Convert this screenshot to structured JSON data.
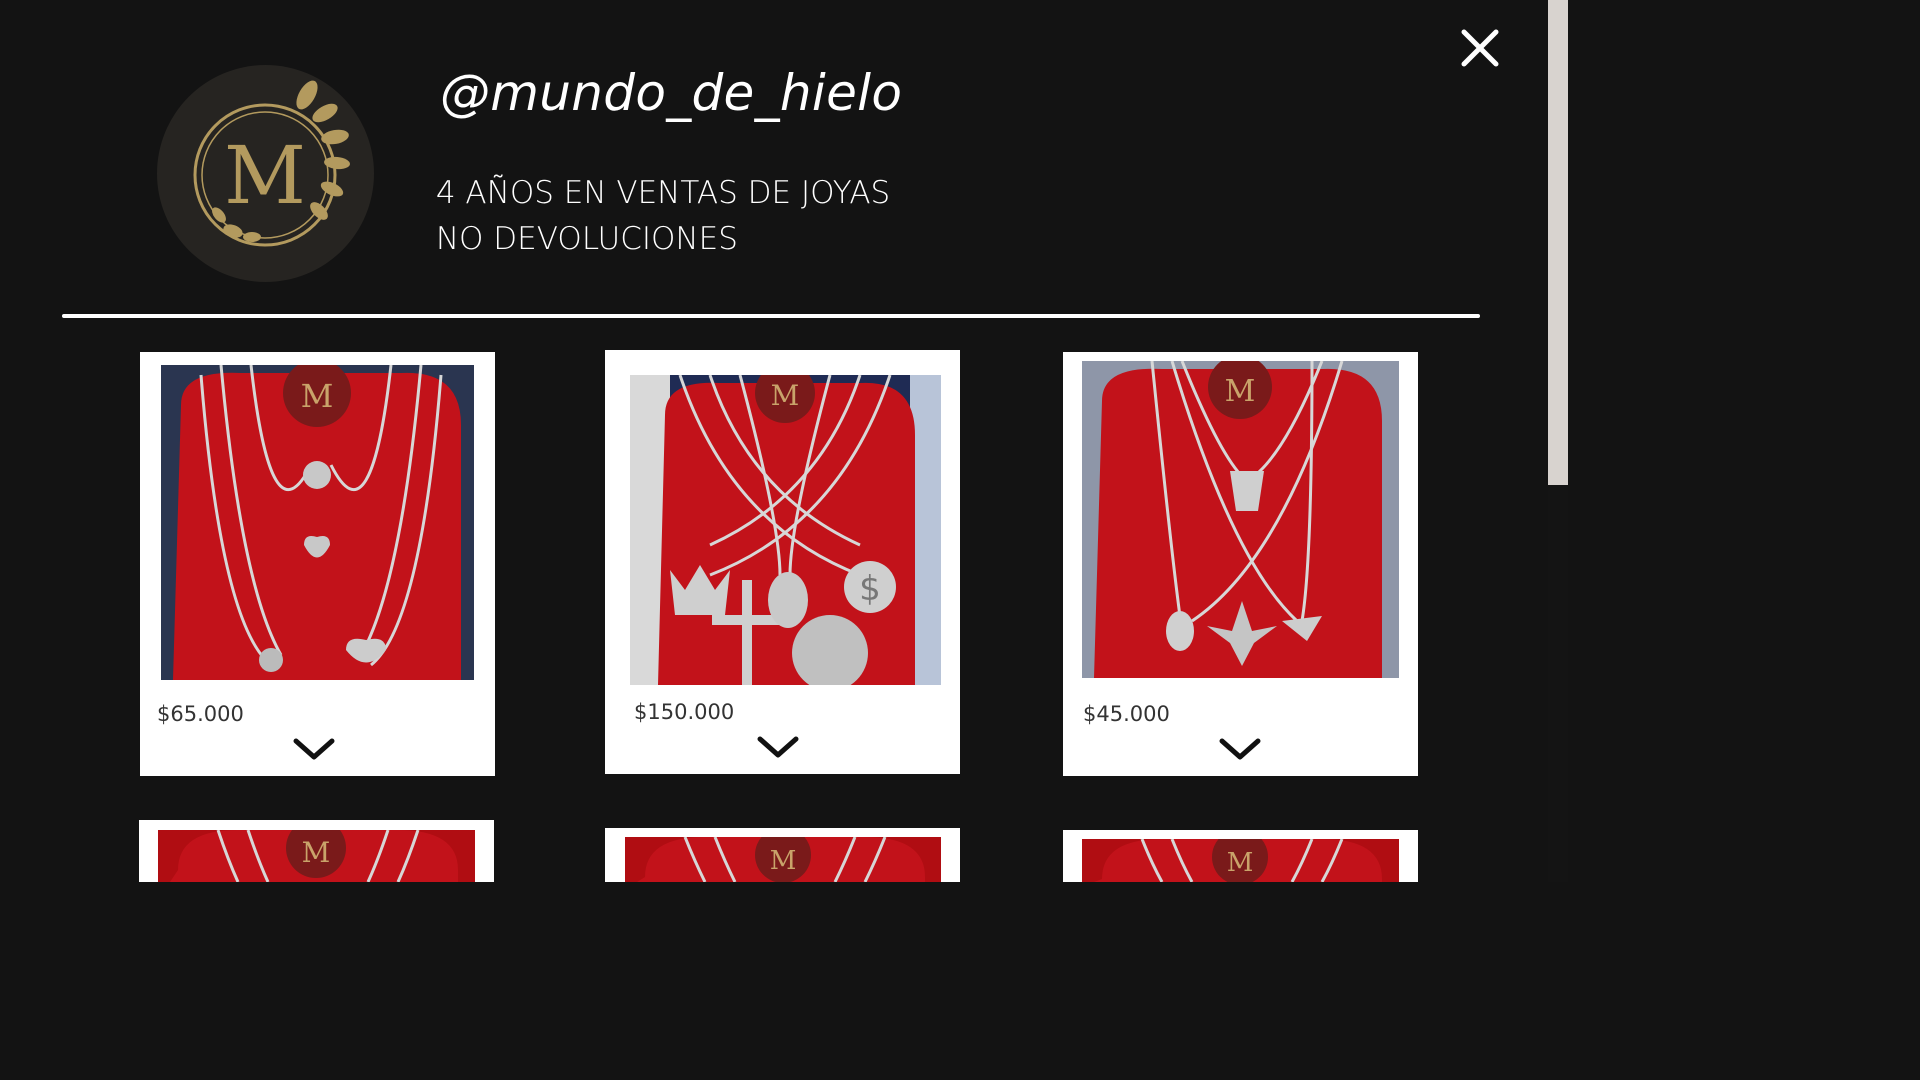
{
  "profile": {
    "handle": "@mundo_de_hielo",
    "bio_line_1": " 4 AÑOS EN VENTAS DE JOYAS ",
    "bio_line_2": " NO DEVOLUCIONES ",
    "logo_letter": "M"
  },
  "colors": {
    "background": "#131313",
    "gold": "#b39a5e",
    "velvet_red": "#c2121a",
    "card": "#ffffff"
  },
  "icons": {
    "close": "close-icon",
    "expand": "chevron-down-icon"
  },
  "products": [
    {
      "price": "$65.000"
    },
    {
      "price": "$150.000"
    },
    {
      "price": "$45.000"
    }
  ]
}
